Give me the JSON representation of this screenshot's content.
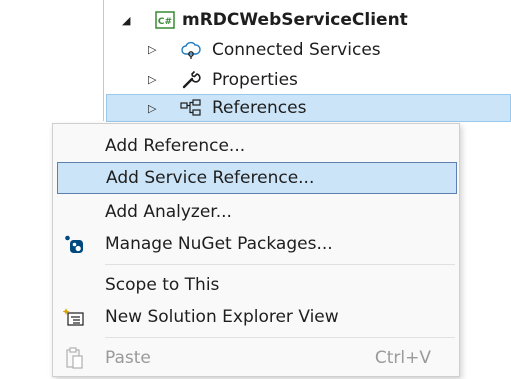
{
  "tree": {
    "project": {
      "label": "mRDCWebServiceClient",
      "icon": "csharp-project-icon",
      "badge": "C#"
    },
    "items": [
      {
        "label": "Connected Services",
        "icon": "connected-services-icon"
      },
      {
        "label": "Properties",
        "icon": "wrench-icon"
      },
      {
        "label": "References",
        "icon": "references-icon",
        "selected": true
      }
    ]
  },
  "menu": {
    "items": [
      {
        "label": "Add Reference..."
      },
      {
        "label": "Add Service Reference...",
        "highlighted": true
      },
      {
        "label": "Add Analyzer..."
      },
      {
        "label": "Manage NuGet Packages...",
        "icon": "nuget-icon"
      },
      {
        "label": "Scope to This"
      },
      {
        "label": "New Solution Explorer View",
        "icon": "new-explorer-view-icon"
      },
      {
        "label": "Paste",
        "icon": "paste-icon",
        "shortcut": "Ctrl+V",
        "disabled": true
      }
    ]
  },
  "colors": {
    "selection_bg": "#cce4f7",
    "selection_border": "#5e7fb0",
    "csharp_green": "#388a34",
    "nuget_blue": "#004880"
  }
}
